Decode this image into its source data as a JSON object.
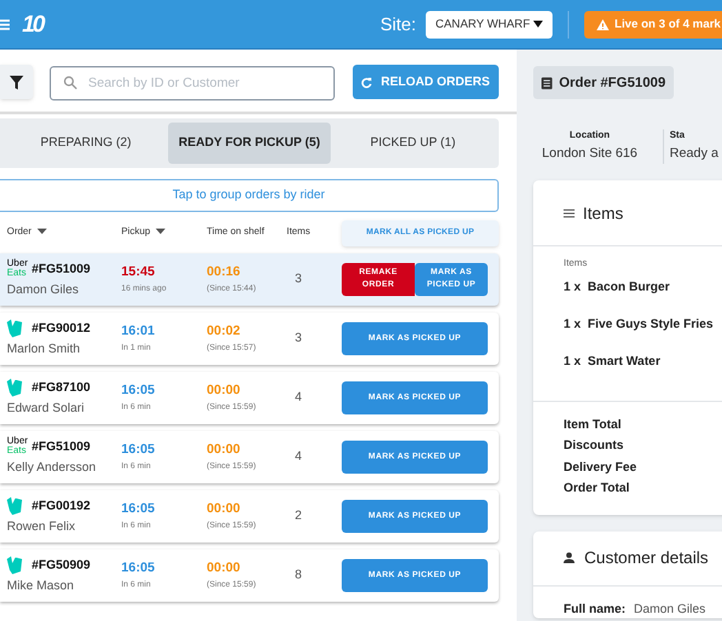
{
  "header": {
    "logo": "10",
    "site_label": "Site:",
    "site_value": "CANARY WHARF",
    "live_badge": "Live on 3 of 4 mark"
  },
  "toolbar": {
    "search": {
      "placeholder": "Search by ID or Customer"
    },
    "reload_button": "RELOAD ORDERS"
  },
  "tabs": [
    {
      "label": "PREPARING (2)",
      "selected": false
    },
    {
      "label": "READY FOR PICKUP (5)",
      "selected": true
    },
    {
      "label": "PICKED UP (1)",
      "selected": false
    }
  ],
  "group_button": "Tap to group orders by rider",
  "table": {
    "columns": [
      "Order",
      "Pickup",
      "Time on shelf",
      "Items"
    ],
    "mark_all_button": "MARK ALL AS PICKED UP",
    "rows": [
      {
        "source": {
          "kind": "uber_eats",
          "lines": [
            "Uber",
            "Eats"
          ]
        },
        "order": "#FG51009",
        "customer": "Damon Giles",
        "pickup": "15:45",
        "late": true,
        "pickup_note": "16 mins ago",
        "shelf": "00:16",
        "shelf_note": "(Since 15:44)",
        "items": "3",
        "selected": true,
        "buttons": [
          {
            "kind": "remake",
            "label": "REMAKE ORDER"
          },
          {
            "kind": "picked",
            "label": "MARK AS PICKED UP"
          }
        ]
      },
      {
        "source": {
          "kind": "deliveroo"
        },
        "order": "#FG90012",
        "customer": "Marlon Smith",
        "pickup": "16:01",
        "late": false,
        "pickup_note": "In 1 min",
        "shelf": "00:02",
        "shelf_note": "(Since 15:57)",
        "items": "3",
        "selected": false,
        "buttons": [
          {
            "kind": "picked",
            "label": "MARK AS PICKED UP"
          }
        ]
      },
      {
        "source": {
          "kind": "deliveroo"
        },
        "order": "#FG87100",
        "customer": "Edward Solari",
        "pickup": "16:05",
        "late": false,
        "pickup_note": "In 6 min",
        "shelf": "00:00",
        "shelf_note": "(Since 15:59)",
        "items": "4",
        "selected": false,
        "buttons": [
          {
            "kind": "picked",
            "label": "MARK AS PICKED UP"
          }
        ]
      },
      {
        "source": {
          "kind": "uber_eats",
          "lines": [
            "Uber",
            "Eats"
          ]
        },
        "order": "#FG51009",
        "customer": "Kelly Andersson",
        "pickup": "16:05",
        "late": false,
        "pickup_note": "In 6 min",
        "shelf": "00:00",
        "shelf_note": "(Since 15:59)",
        "items": "4",
        "selected": false,
        "buttons": [
          {
            "kind": "picked",
            "label": "MARK AS PICKED UP"
          }
        ]
      },
      {
        "source": {
          "kind": "deliveroo"
        },
        "order": "#FG00192",
        "customer": "Rowen Felix",
        "pickup": "16:05",
        "late": false,
        "pickup_note": "In 6 min",
        "shelf": "00:00",
        "shelf_note": "(Since 15:59)",
        "items": "2",
        "selected": false,
        "buttons": [
          {
            "kind": "picked",
            "label": "MARK AS PICKED UP"
          }
        ]
      },
      {
        "source": {
          "kind": "deliveroo"
        },
        "order": "#FG50909",
        "customer": "Mike Mason",
        "pickup": "16:05",
        "late": false,
        "pickup_note": "In 6 min",
        "shelf": "00:00",
        "shelf_note": "(Since 15:59)",
        "items": "8",
        "selected": false,
        "buttons": [
          {
            "kind": "picked",
            "label": "MARK AS PICKED UP"
          }
        ]
      }
    ]
  },
  "detail": {
    "order_chip": "Order #FG51009",
    "info": [
      {
        "label": "Location",
        "value": "London Site 616"
      },
      {
        "label": "Sta",
        "value": "Ready a"
      }
    ],
    "items_card": {
      "title": "Items",
      "subtitle": "Items",
      "lines": [
        "1 x  Bacon Burger",
        "1 x  Five Guys Style Fries",
        "1 x  Smart Water"
      ],
      "totals": [
        "Item Total",
        "Discounts",
        "Delivery Fee",
        "Order Total"
      ]
    },
    "customer_card": {
      "title": "Customer details",
      "fields": [
        {
          "label": "Full name:",
          "value": "Damon Giles"
        }
      ]
    }
  }
}
